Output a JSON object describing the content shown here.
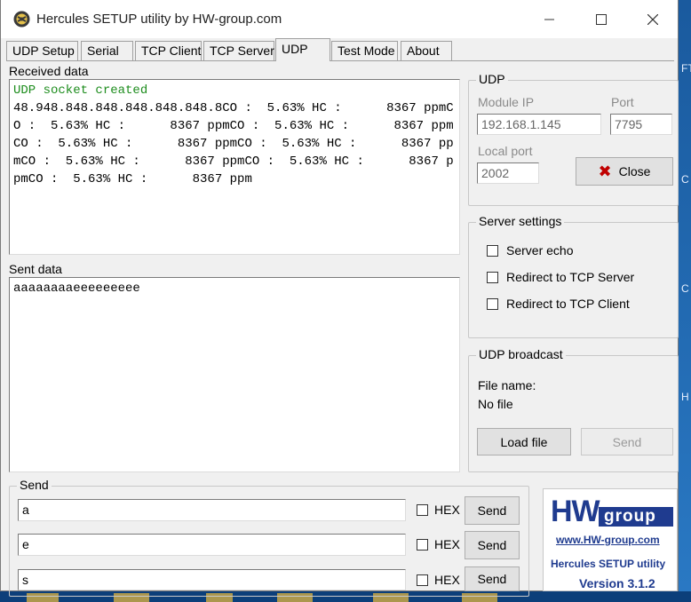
{
  "window": {
    "title": "Hercules SETUP utility by HW-group.com",
    "controls": {
      "minimize": "—",
      "maximize": "☐",
      "close": "✕"
    }
  },
  "tabs": [
    {
      "label": "UDP Setup"
    },
    {
      "label": "Serial"
    },
    {
      "label": "TCP Client"
    },
    {
      "label": "TCP Server"
    },
    {
      "label": "UDP",
      "active": true
    },
    {
      "label": "Test Mode"
    },
    {
      "label": "About"
    }
  ],
  "received": {
    "label": "Received data",
    "status_line": "UDP socket created",
    "content": "48.948.848.848.848.848.848.8CO :  5.63% HC :      8367 ppmCO :  5.63% HC :      8367 ppmCO :  5.63% HC :      8367 ppmCO :  5.63% HC :      8367 ppmCO :  5.63% HC :      8367 ppmCO :  5.63% HC :      8367 ppmCO :  5.63% HC :      8367 ppmCO :  5.63% HC :      8367 ppm"
  },
  "sent": {
    "label": "Sent data",
    "content": "aaaaaaaaeeeeeeeee"
  },
  "udp": {
    "group_title": "UDP",
    "module_ip_label": "Module IP",
    "module_ip_value": "192.168.1.145",
    "port_label": "Port",
    "port_value": "7795",
    "local_port_label": "Local port",
    "local_port_value": "2002",
    "close_label": "Close"
  },
  "server_settings": {
    "group_title": "Server settings",
    "options": [
      {
        "label": "Server echo",
        "checked": false
      },
      {
        "label": "Redirect to TCP Server",
        "checked": false
      },
      {
        "label": "Redirect to TCP Client",
        "checked": false
      }
    ]
  },
  "broadcast": {
    "group_title": "UDP broadcast",
    "file_name_label": "File name:",
    "file_name_value": "No file",
    "load_file_label": "Load file",
    "send_label": "Send"
  },
  "send_panel": {
    "group_title": "Send",
    "rows": [
      {
        "value": "a",
        "hex_label": "HEX",
        "send_label": "Send"
      },
      {
        "value": "e",
        "hex_label": "HEX",
        "send_label": "Send"
      },
      {
        "value": "s",
        "hex_label": "HEX",
        "send_label": "Send"
      }
    ]
  },
  "logo": {
    "hw": "HW",
    "group": "group",
    "url": "www.HW-group.com",
    "product": "Hercules SETUP utility",
    "version": "Version  3.1.2"
  },
  "desktop_chars": [
    "FT",
    "C",
    "C",
    "H"
  ],
  "colors": {
    "received_status": "#1c8c1c",
    "close_icon": "#c00000",
    "logo_blue": "#1f3b8f",
    "desktop": "#1f6fb5"
  }
}
